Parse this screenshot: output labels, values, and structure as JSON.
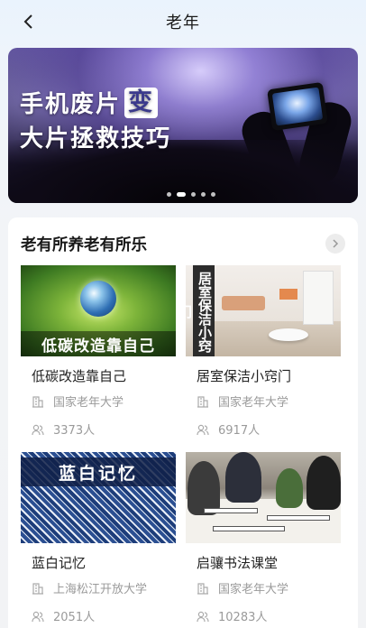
{
  "header": {
    "title": "老年",
    "back_icon": "chevron-left-icon"
  },
  "banner": {
    "line1": "手机废片",
    "badge": "变",
    "line2": "大片拯救技巧",
    "dots_count": 5,
    "active_dot": 1
  },
  "section": {
    "title": "老有所养老有所乐",
    "more_icon": "chevron-right-icon",
    "courses": [
      {
        "thumb_caption": "低碳改造靠自己",
        "name": "低碳改造靠自己",
        "school": "国家老年大学",
        "count": "3373人"
      },
      {
        "thumb_caption": "居室保洁小窍门",
        "name": "居室保洁小窍门",
        "school": "国家老年大学",
        "count": "6917人"
      },
      {
        "thumb_caption": "蓝白记忆",
        "name": "蓝白记忆",
        "school": "上海松江开放大学",
        "count": "2051人"
      },
      {
        "thumb_caption": "",
        "name": "启骧书法课堂",
        "school": "国家老年大学",
        "count": "10283人"
      }
    ]
  },
  "colors": {
    "accent": "#3b3a8c",
    "meta_gray": "#9a9a9a"
  }
}
